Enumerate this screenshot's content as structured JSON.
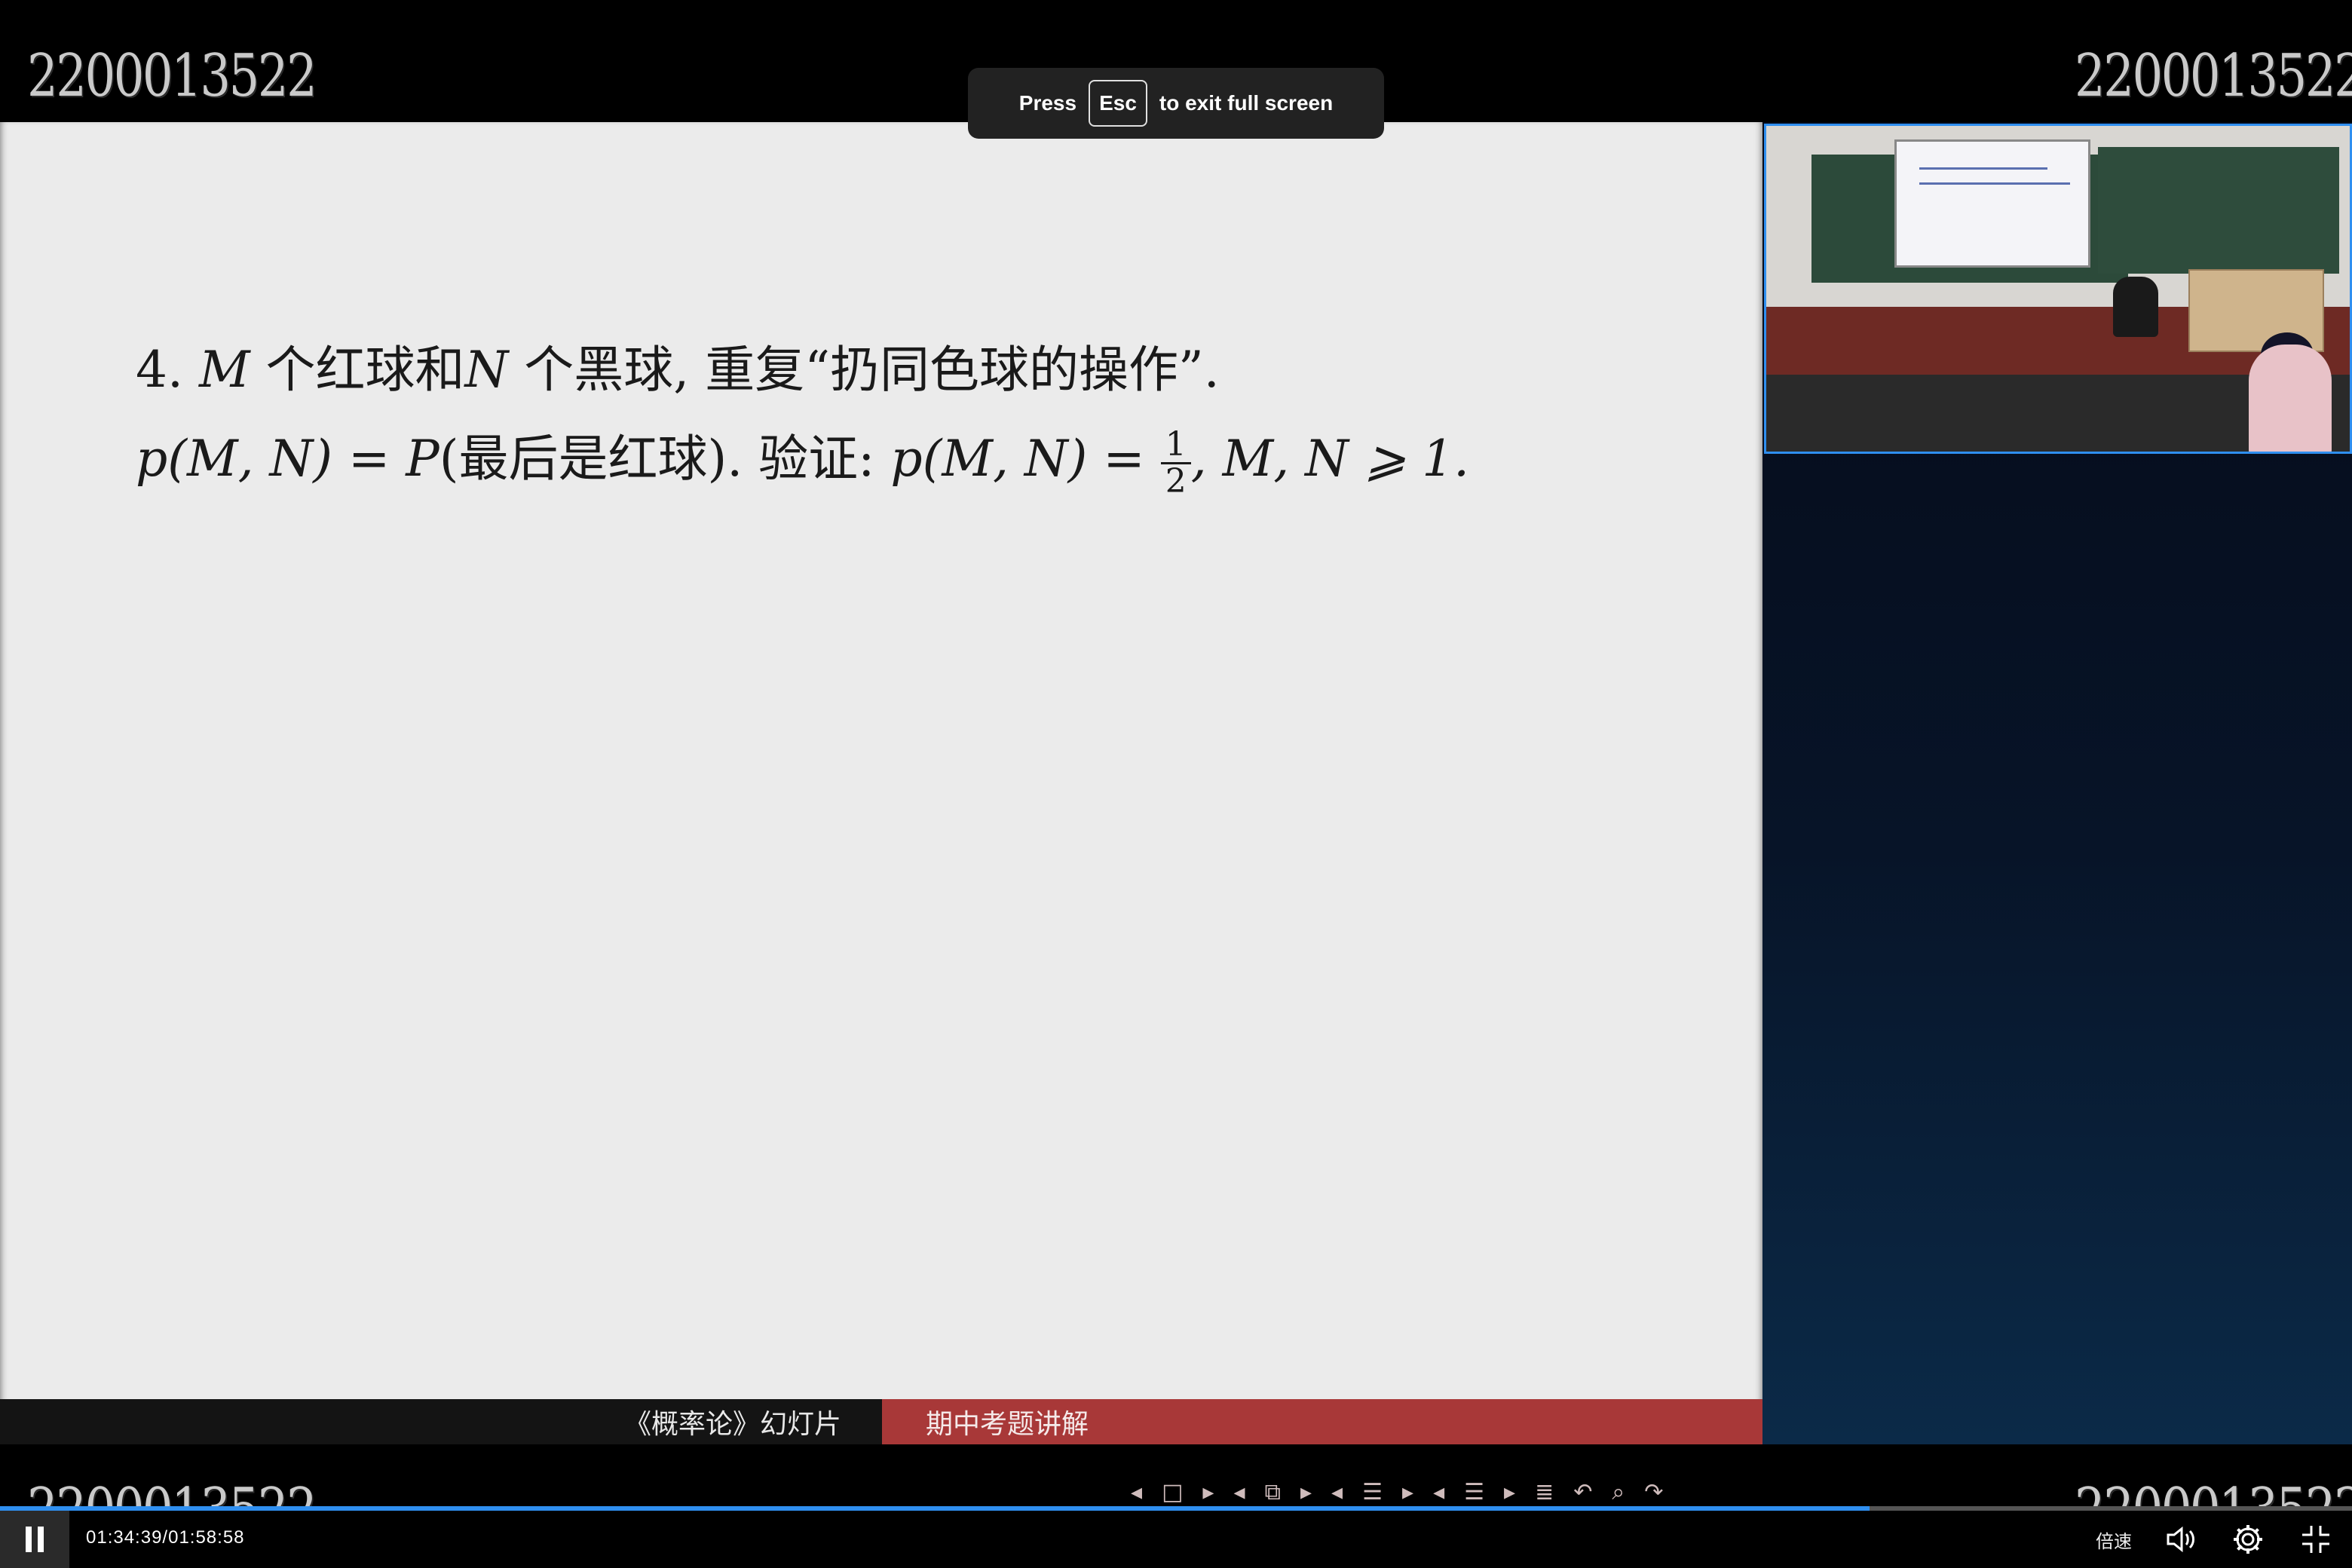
{
  "watermark": {
    "text": "2200013522"
  },
  "fullscreen_toast": {
    "prefix": "Press",
    "key": "Esc",
    "suffix": "to exit full screen"
  },
  "slide": {
    "line1_prefix": "4. ",
    "line1_M": "M",
    "line1_mid": " 个红球和",
    "line1_N": "N",
    "line1_rest": " 个黑球, 重复“扔同色球的操作”.",
    "line2_lhs": "p(M, N) = P",
    "line2_text": "(最后是红球). 验证: ",
    "line2_eq": "p(M, N) = ",
    "frac_num": "1",
    "frac_den": "2",
    "line2_tail": ", M, N ⩾ 1."
  },
  "footer": {
    "left": "《概率论》幻灯片",
    "right": "期中考题讲解"
  },
  "player": {
    "progress": 0.795,
    "time": "01:34:39/01:58:58",
    "speed_label": "倍速"
  },
  "icons": {
    "pause": "pause-icon",
    "volume": "volume-icon",
    "settings": "gear-icon",
    "exit_fullscreen": "exit-fullscreen-icon"
  },
  "colors": {
    "accent": "#2f8ff0",
    "footer_red": "#a83838",
    "slide_bg": "#ebebeb"
  }
}
